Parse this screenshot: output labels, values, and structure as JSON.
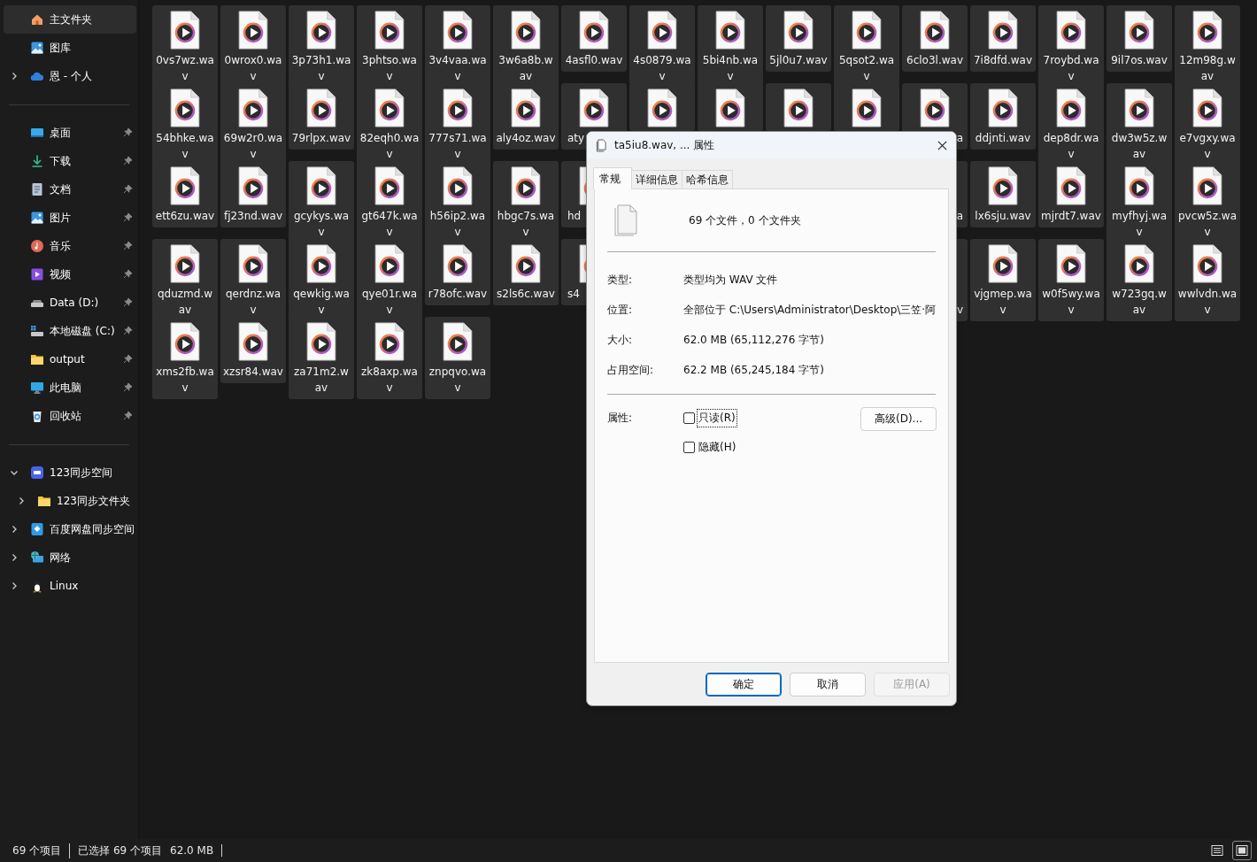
{
  "sidebar": {
    "sections": [
      {
        "items": [
          {
            "label": "主文件夹",
            "selected": true
          },
          {
            "label": "图库",
            "selected": false
          },
          {
            "label": "恩 - 个人",
            "selected": false,
            "expanded": false
          }
        ]
      },
      {
        "items": [
          {
            "label": "桌面",
            "selected": false,
            "pinned": true
          },
          {
            "label": "下载",
            "selected": false,
            "pinned": true
          },
          {
            "label": "文档",
            "selected": false,
            "pinned": true
          },
          {
            "label": "图片",
            "selected": false,
            "pinned": true
          },
          {
            "label": "音乐",
            "selected": false,
            "pinned": true
          },
          {
            "label": "视频",
            "selected": false,
            "pinned": true
          },
          {
            "label": "Data (D:)",
            "selected": false,
            "pinned": true
          },
          {
            "label": "本地磁盘 (C:)",
            "selected": false,
            "pinned": true
          },
          {
            "label": "output",
            "selected": false,
            "pinned": true
          },
          {
            "label": "此电脑",
            "selected": false,
            "pinned": true
          },
          {
            "label": "回收站",
            "selected": false,
            "pinned": true
          }
        ]
      },
      {
        "items": [
          {
            "label": "123同步空间",
            "selected": false,
            "expanded": true,
            "children": [
              {
                "label": "123同步文件夹",
                "selected": false,
                "expanded": false
              }
            ]
          },
          {
            "label": "百度网盘同步空间",
            "selected": false,
            "expanded": false
          },
          {
            "label": "网络",
            "selected": false,
            "expanded": false
          },
          {
            "label": "Linux",
            "selected": false,
            "expanded": false
          }
        ]
      }
    ]
  },
  "files": [
    {
      "kind": "file",
      "name": "0vs7wz.wav",
      "selected": true
    },
    {
      "kind": "file",
      "name": "0wrox0.wav",
      "selected": true
    },
    {
      "kind": "file",
      "name": "3p73h1.wav",
      "selected": true
    },
    {
      "kind": "file",
      "name": "3phtso.wav",
      "selected": true
    },
    {
      "kind": "file",
      "name": "3v4vaa.wav",
      "selected": true
    },
    {
      "kind": "file",
      "name": "3w6a8b.wav",
      "selected": true
    },
    {
      "kind": "file",
      "name": "4asfl0.wav",
      "selected": true
    },
    {
      "kind": "file",
      "name": "4s0879.wav",
      "selected": true
    },
    {
      "kind": "file",
      "name": "5bi4nb.wav",
      "selected": true
    },
    {
      "kind": "file",
      "name": "5jl0u7.wav",
      "selected": true
    },
    {
      "kind": "file",
      "name": "5qsot2.wav",
      "selected": true
    },
    {
      "kind": "file",
      "name": "6clo3l.wav",
      "selected": true
    },
    {
      "kind": "file",
      "name": "7i8dfd.wav",
      "selected": true
    },
    {
      "kind": "file",
      "name": "7roybd.wav",
      "selected": true
    },
    {
      "kind": "file",
      "name": "9il7os.wav",
      "selected": true
    },
    {
      "kind": "file",
      "name": "12m98g.wav",
      "selected": true
    },
    {
      "kind": "file",
      "name": "54bhke.wav",
      "selected": true
    },
    {
      "kind": "file",
      "name": "69w2r0.wav",
      "selected": true
    },
    {
      "kind": "file",
      "name": "79rlpx.wav",
      "selected": true
    },
    {
      "kind": "file",
      "name": "82eqh0.wav",
      "selected": true
    },
    {
      "kind": "file",
      "name": "777s71.wav",
      "selected": true
    },
    {
      "kind": "file",
      "name": "aly4oz.wav",
      "selected": true
    },
    {
      "kind": "cut-right",
      "name": "aty",
      "selected": true
    },
    {
      "kind": "covered",
      "selected": true
    },
    {
      "kind": "covered",
      "selected": true
    },
    {
      "kind": "covered",
      "selected": true
    },
    {
      "kind": "covered",
      "selected": true
    },
    {
      "kind": "cut-left",
      "name": "a",
      "selected": true
    },
    {
      "kind": "file",
      "name": "ddjnti.wav",
      "selected": true
    },
    {
      "kind": "file",
      "name": "dep8dr.wav",
      "selected": true
    },
    {
      "kind": "file",
      "name": "dw3w5z.wav",
      "selected": true
    },
    {
      "kind": "file",
      "name": "e7vgxy.wav",
      "selected": true
    },
    {
      "kind": "file",
      "name": "ett6zu.wav",
      "selected": true
    },
    {
      "kind": "file",
      "name": "fj23nd.wav",
      "selected": true
    },
    {
      "kind": "file",
      "name": "gcykys.wav",
      "selected": true
    },
    {
      "kind": "file",
      "name": "gt647k.wav",
      "selected": true
    },
    {
      "kind": "file",
      "name": "h56ip2.wav",
      "selected": true
    },
    {
      "kind": "file",
      "name": "hbgc7s.wav",
      "selected": true
    },
    {
      "kind": "cut-right",
      "name": "hd",
      "selected": true
    },
    {
      "kind": "hidden"
    },
    {
      "kind": "hidden"
    },
    {
      "kind": "hidden"
    },
    {
      "kind": "hidden"
    },
    {
      "kind": "edge",
      "name": "a",
      "selected": true
    },
    {
      "kind": "file",
      "name": "lx6sju.wav",
      "selected": true
    },
    {
      "kind": "file",
      "name": "mjrdt7.wav",
      "selected": true
    },
    {
      "kind": "file",
      "name": "myfhyj.wav",
      "selected": true
    },
    {
      "kind": "file",
      "name": "pvcw5z.wav",
      "selected": true
    },
    {
      "kind": "file",
      "name": "qduzmd.wav",
      "selected": true
    },
    {
      "kind": "file",
      "name": "qerdnz.wav",
      "selected": true
    },
    {
      "kind": "file",
      "name": "qewkig.wav",
      "selected": true
    },
    {
      "kind": "file",
      "name": "qye01r.wav",
      "selected": true
    },
    {
      "kind": "file",
      "name": "r78ofc.wav",
      "selected": true
    },
    {
      "kind": "file",
      "name": "s2ls6c.wav",
      "selected": true
    },
    {
      "kind": "cut-right",
      "name": "s4",
      "selected": true
    },
    {
      "kind": "hidden"
    },
    {
      "kind": "hidden"
    },
    {
      "kind": "hidden"
    },
    {
      "kind": "hidden"
    },
    {
      "kind": "edge-end",
      "name": "v",
      "selected": true
    },
    {
      "kind": "file",
      "name": "vjgmep.wav",
      "selected": true
    },
    {
      "kind": "file",
      "name": "w0f5wy.wav",
      "selected": true
    },
    {
      "kind": "file",
      "name": "w723gq.wav",
      "selected": true
    },
    {
      "kind": "file",
      "name": "wwlvdn.wav",
      "selected": true
    },
    {
      "kind": "file",
      "name": "xms2fb.wav",
      "selected": true
    },
    {
      "kind": "file",
      "name": "xzsr84.wav",
      "selected": true
    },
    {
      "kind": "file",
      "name": "za71m2.wav",
      "selected": true
    },
    {
      "kind": "file",
      "name": "zk8axp.wav",
      "selected": true
    },
    {
      "kind": "file",
      "name": "znpqvo.wav",
      "selected": true
    }
  ],
  "dialog": {
    "title": "ta5iu8.wav, ... 属性",
    "tabs": [
      {
        "label": "常规",
        "selected": true
      },
      {
        "label": "详细信息",
        "selected": false
      },
      {
        "label": "哈希信息",
        "selected": false
      }
    ],
    "summary": "69 个文件，0 个文件夹",
    "properties": [
      {
        "label": "类型:",
        "value": "类型均为 WAV 文件"
      },
      {
        "label": "位置:",
        "value": "全部位于 C:\\Users\\Administrator\\Desktop\\三笠·阿"
      },
      {
        "label": "大小:",
        "value": "62.0 MB (65,112,276 字节)"
      },
      {
        "label": "占用空间:",
        "value": "62.2 MB (65,245,184 字节)"
      }
    ],
    "attributes_label": "属性:",
    "checkboxes": [
      {
        "label": "只读(R)",
        "checked": false,
        "focused": true
      },
      {
        "label": "隐藏(H)",
        "checked": false,
        "focused": false
      }
    ],
    "advanced_button": "高级(D)...",
    "buttons": [
      {
        "label": "确定",
        "default": true,
        "disabled": false
      },
      {
        "label": "取消",
        "default": false,
        "disabled": false
      },
      {
        "label": "应用(A)",
        "default": false,
        "disabled": true
      }
    ]
  },
  "status_bar": {
    "item_count": "69 个项目",
    "selection": "已选择 69 个项目",
    "selection_size": "62.0 MB",
    "view_modes": [
      {
        "selected": false
      },
      {
        "selected": true
      }
    ]
  }
}
